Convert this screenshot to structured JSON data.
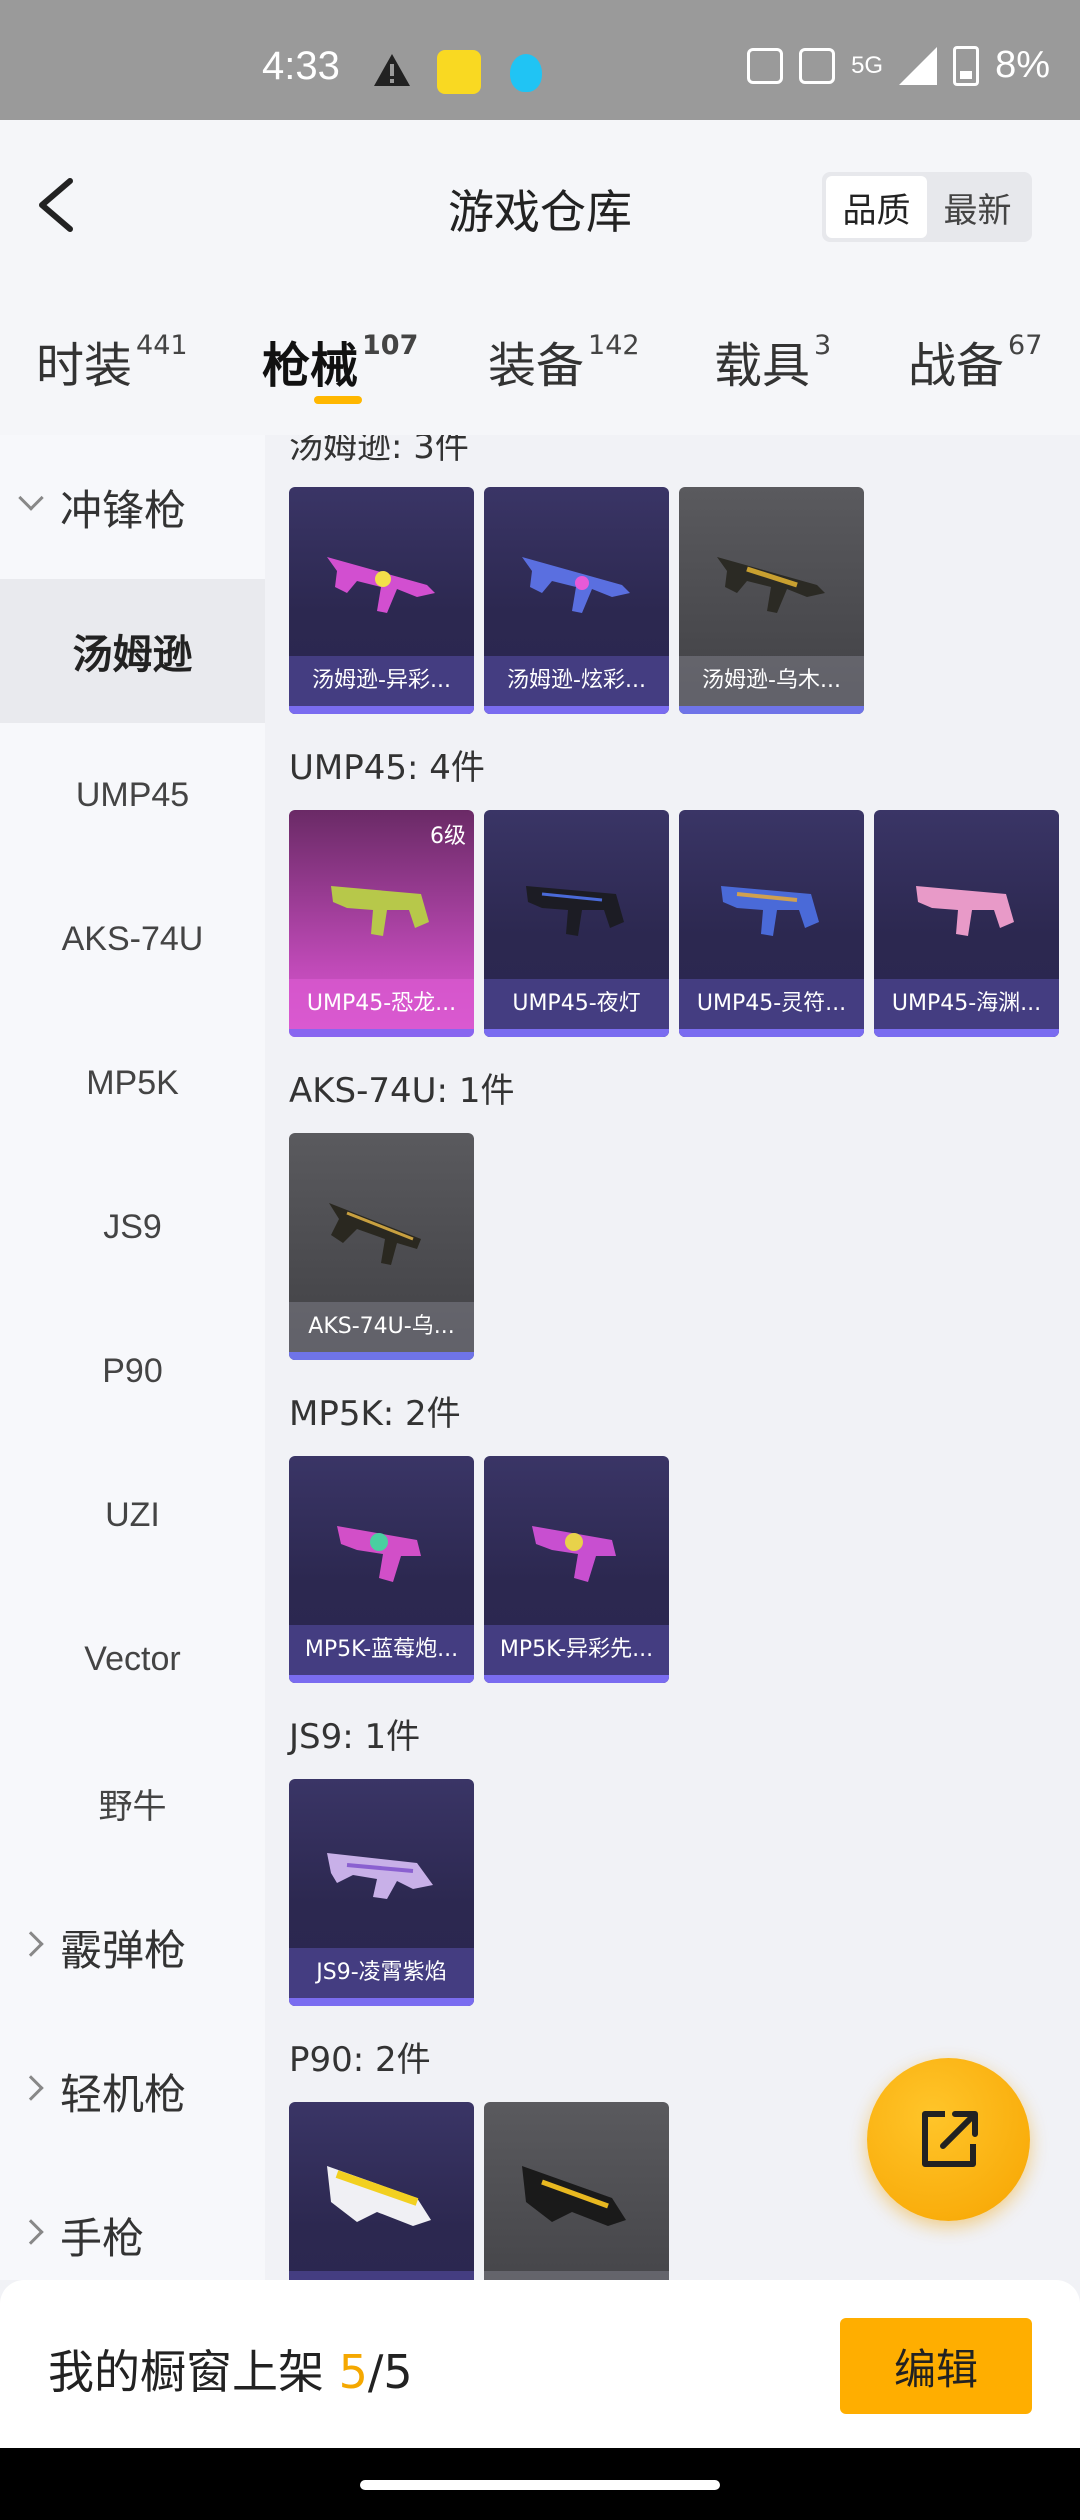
{
  "status_bar": {
    "time": "4:33",
    "network": "5G",
    "battery": "8%"
  },
  "header": {
    "title": "游戏仓库",
    "sort_options": [
      "品质",
      "最新"
    ]
  },
  "tabs": [
    {
      "label": "时装",
      "count": "441"
    },
    {
      "label": "枪械",
      "count": "107"
    },
    {
      "label": "装备",
      "count": "142"
    },
    {
      "label": "载具",
      "count": "3"
    },
    {
      "label": "战备",
      "count": "67"
    }
  ],
  "sidebar": {
    "group_smg": "冲锋枪",
    "items": [
      "汤姆逊",
      "UMP45",
      "AKS-74U",
      "MP5K",
      "JS9",
      "P90",
      "UZI",
      "Vector",
      "野牛"
    ],
    "group_shotgun": "霰弹枪",
    "group_lmg": "轻机枪",
    "group_pistol": "手枪"
  },
  "sections": [
    {
      "title": "汤姆逊: 3件",
      "items": [
        "汤姆逊-异彩...",
        "汤姆逊-炫彩...",
        "汤姆逊-乌木..."
      ]
    },
    {
      "title": "UMP45: 4件",
      "items": [
        "UMP45-恐龙...",
        "UMP45-夜灯",
        "UMP45-灵符...",
        "UMP45-海渊..."
      ],
      "level_badge": "6级"
    },
    {
      "title": "AKS-74U: 1件",
      "items": [
        "AKS-74U-乌..."
      ]
    },
    {
      "title": "MP5K: 2件",
      "items": [
        "MP5K-蓝莓炮...",
        "MP5K-异彩先..."
      ]
    },
    {
      "title": "JS9: 1件",
      "items": [
        "JS9-凌霄紫焰"
      ]
    },
    {
      "title": "P90: 2件",
      "items": [
        "",
        ""
      ]
    }
  ],
  "bottom": {
    "label": "我的橱窗上架",
    "current": "5",
    "total": "/5",
    "edit": "编辑"
  },
  "colors": {
    "accent": "#ffae00",
    "card_purple": "#2c2850",
    "rarity": "#7a6cf0"
  },
  "icons": {
    "back": "chevron-left-icon",
    "share": "share-external-icon"
  }
}
